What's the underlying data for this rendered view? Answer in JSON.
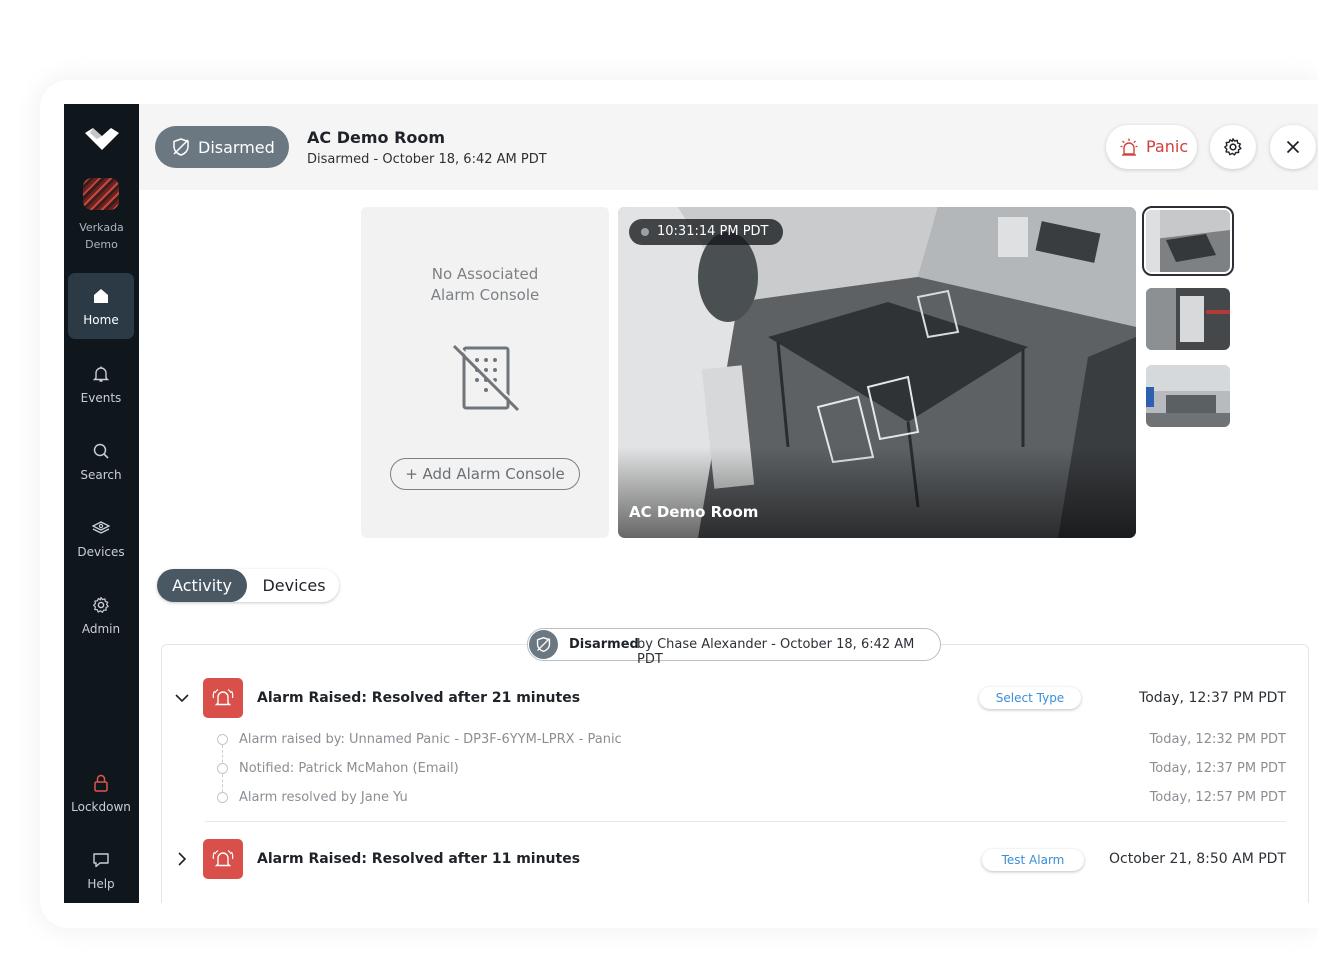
{
  "sidebar": {
    "org_name": "Verkada\nDemo",
    "items": [
      {
        "label": "Home",
        "icon": "home-icon"
      },
      {
        "label": "Events",
        "icon": "bell-icon"
      },
      {
        "label": "Search",
        "icon": "search-icon"
      },
      {
        "label": "Devices",
        "icon": "devices-icon"
      },
      {
        "label": "Admin",
        "icon": "gear-icon"
      },
      {
        "label": "Lockdown",
        "icon": "lock-icon"
      },
      {
        "label": "Help",
        "icon": "chat-icon"
      }
    ],
    "active": "Home",
    "lockdown_color": "#e0554f"
  },
  "header": {
    "status_label": "Disarmed",
    "title": "AC Demo Room",
    "subtitle": "Disarmed - October 18, 6:42 AM PDT",
    "panic_label": "Panic",
    "panic_color": "#d0403c"
  },
  "console": {
    "message": "No Associated\nAlarm Console",
    "add_label": "+ Add Alarm Console"
  },
  "camera": {
    "timestamp": "10:31:14 PM PDT",
    "name": "AC Demo Room"
  },
  "tabs": [
    {
      "label": "Activity",
      "active": true
    },
    {
      "label": "Devices",
      "active": false
    }
  ],
  "activity": {
    "disarm_banner": {
      "bold": "Disarmed",
      "rest": "by Chase Alexander - October 18, 6:42 AM PDT"
    },
    "alarms": [
      {
        "title": "Alarm Raised: Resolved after 21 minutes",
        "type": "Select Type",
        "time": "Today, 12:37 PM PDT",
        "expanded": true,
        "details": [
          {
            "text": "Alarm raised by: Unnamed Panic - DP3F-6YYM-LPRX - Panic",
            "time": "Today, 12:32 PM PDT"
          },
          {
            "text": "Notified: Patrick McMahon (Email)",
            "time": "Today, 12:37 PM PDT"
          },
          {
            "text": "Alarm resolved by Jane Yu",
            "time": "Today, 12:57 PM PDT"
          }
        ]
      },
      {
        "title": "Alarm Raised: Resolved after 11 minutes",
        "type": "Test Alarm",
        "time": "October 21, 8:50 AM PDT",
        "expanded": false
      }
    ],
    "alarm_color": "#d9504a",
    "type_color": "#3a8fd6"
  }
}
